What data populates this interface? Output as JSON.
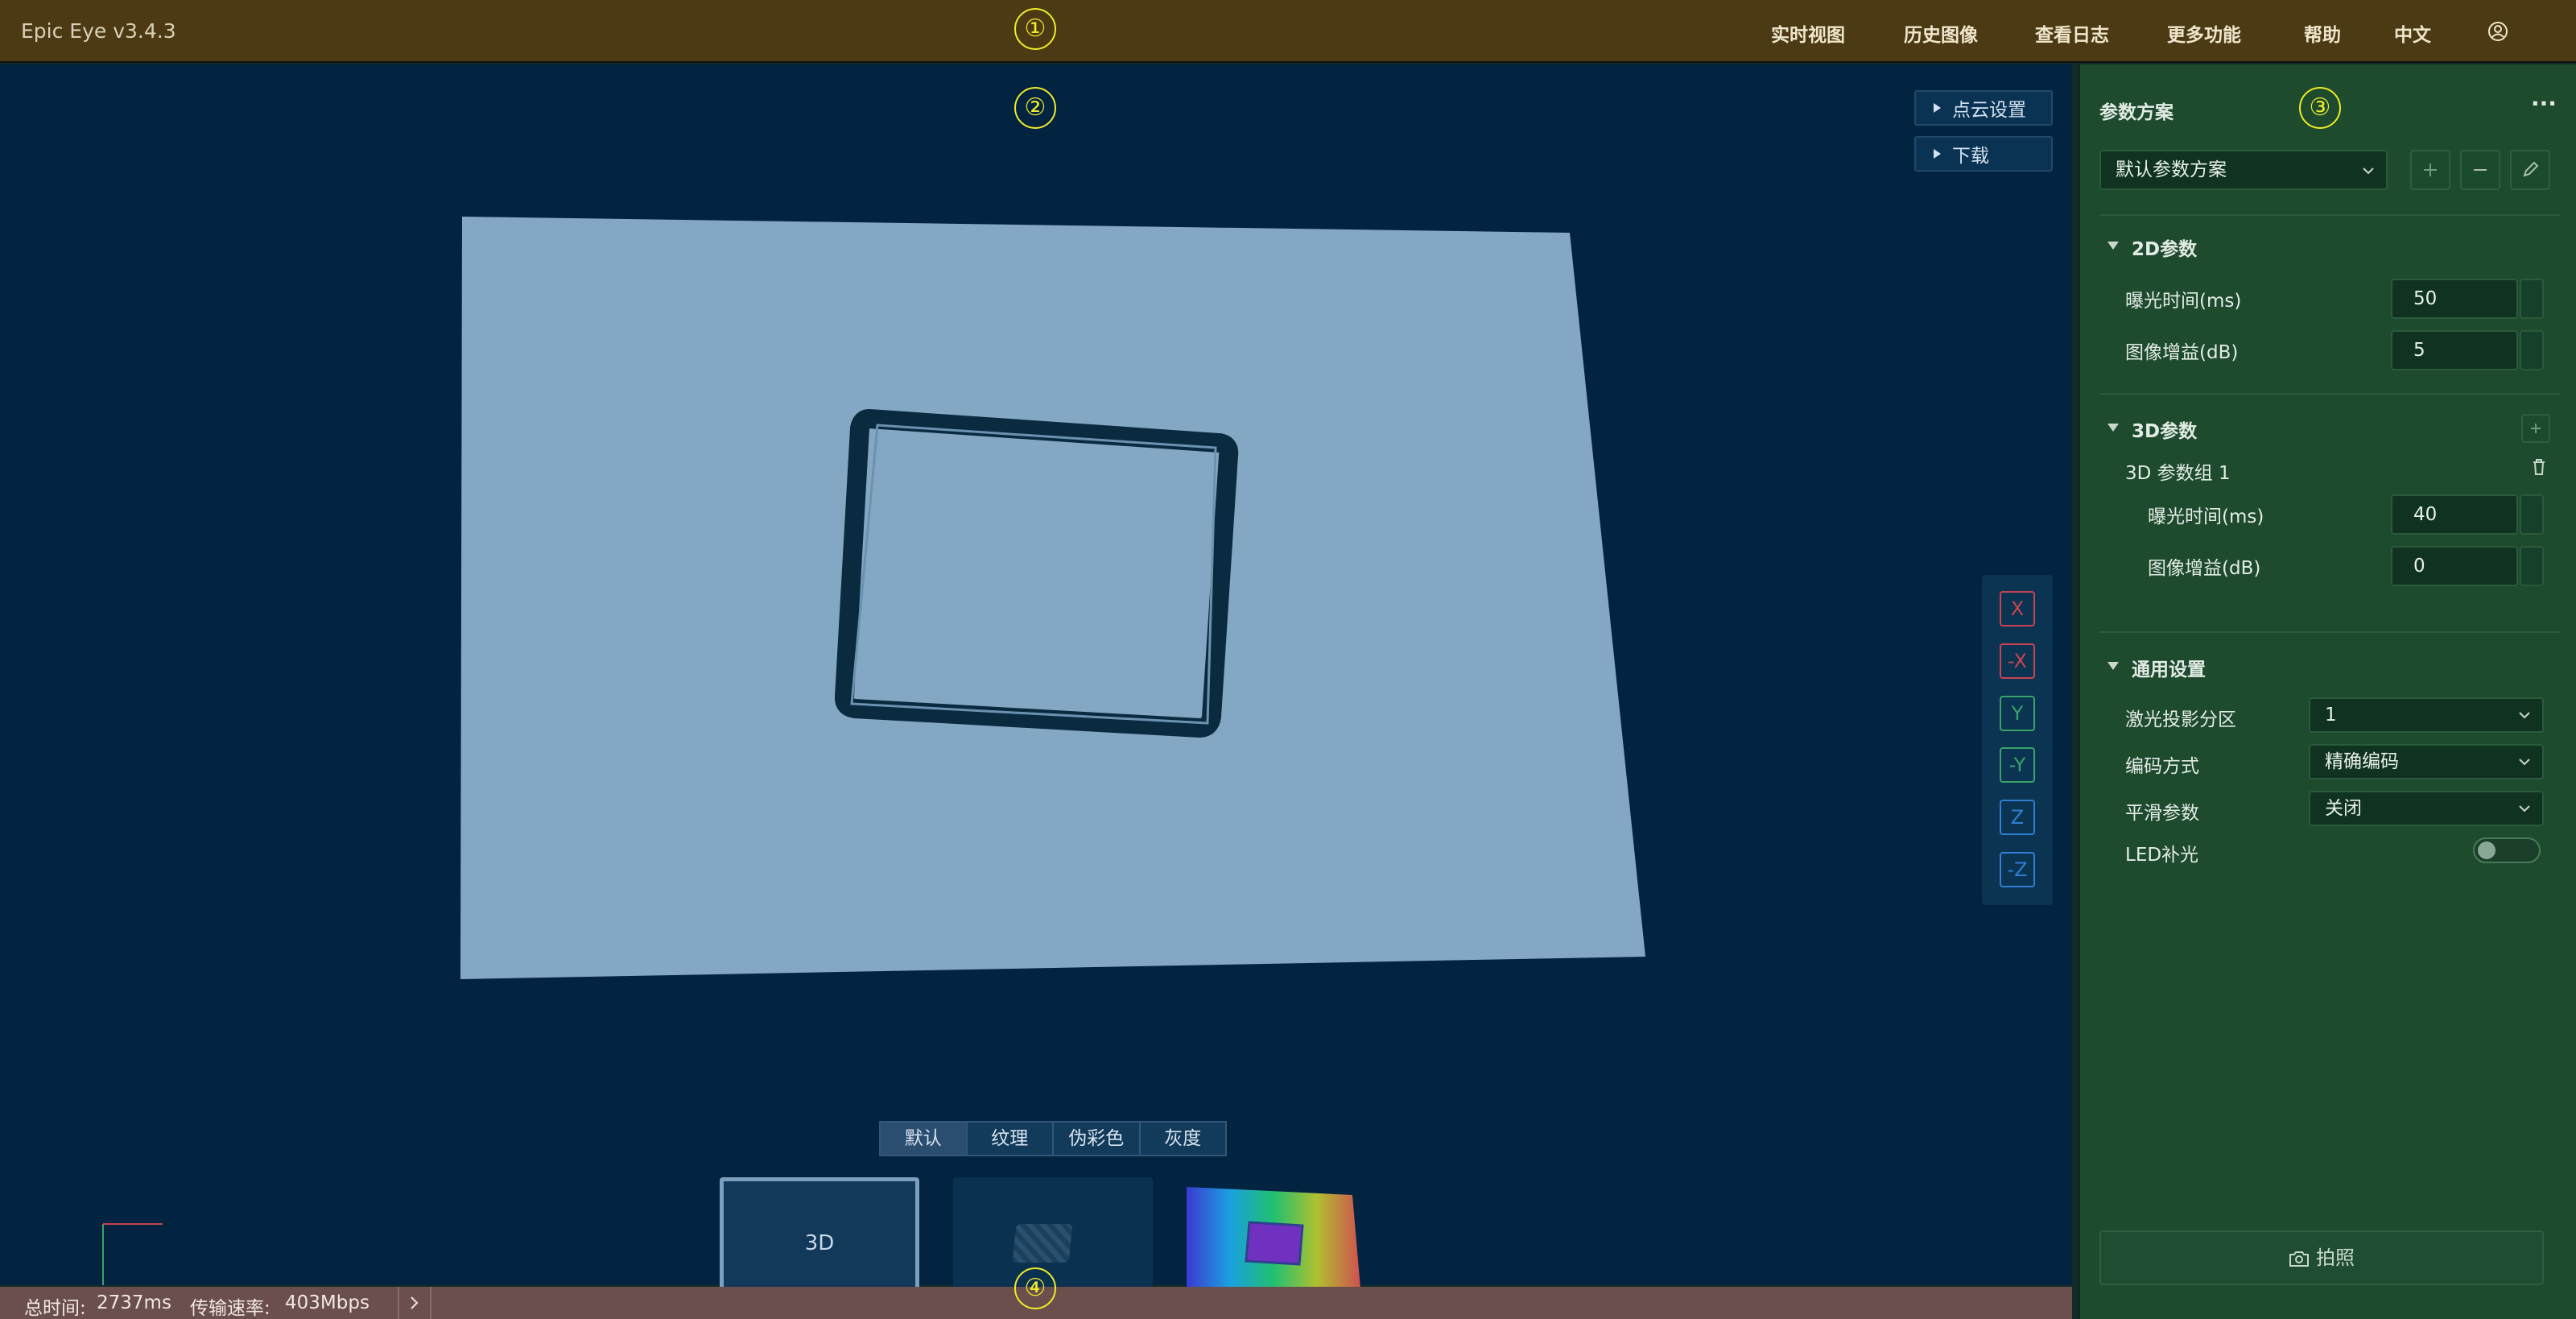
{
  "header": {
    "brand": "Epic Eye v3.4.3",
    "nav": [
      "实时视图",
      "历史图像",
      "查看日志",
      "更多功能",
      "帮助",
      "中文"
    ],
    "user_icon": "user-circle-icon"
  },
  "markers": [
    "①",
    "②",
    "③",
    "④"
  ],
  "viewer": {
    "buttons": [
      {
        "label": "点云设置",
        "icon": "triangle-right-icon"
      },
      {
        "label": "下载",
        "icon": "triangle-right-icon"
      }
    ],
    "axes": [
      {
        "label": "X",
        "color": "#c9434f"
      },
      {
        "label": "-X",
        "color": "#c9434f"
      },
      {
        "label": "Y",
        "color": "#3aa36a"
      },
      {
        "label": "-Y",
        "color": "#3aa36a"
      },
      {
        "label": "Z",
        "color": "#2f7fd2"
      },
      {
        "label": "-Z",
        "color": "#2f7fd2"
      }
    ],
    "modes": [
      "默认",
      "纹理",
      "伪彩色",
      "灰度"
    ],
    "active_mode": "默认",
    "thumbnails": [
      {
        "label": "3D"
      },
      {
        "label": ""
      },
      {
        "label": ""
      }
    ]
  },
  "status": {
    "total_time_label": "总时间:",
    "total_time_value": "2737ms",
    "rate_label": "传输速率:",
    "rate_value": "403Mbps"
  },
  "panel": {
    "title": "参数方案",
    "scheme": "默认参数方案",
    "sections": {
      "s2d": {
        "title": "2D参数",
        "exposure_label": "曝光时间(ms)",
        "exposure": "50",
        "gain_label": "图像增益(dB)",
        "gain": "5"
      },
      "s3d": {
        "title": "3D参数",
        "group": "3D 参数组 1",
        "exposure_label": "曝光时间(ms)",
        "exposure": "40",
        "gain_label": "图像增益(dB)",
        "gain": "0"
      },
      "general": {
        "title": "通用设置",
        "laser_label": "激光投影分区",
        "laser": "1",
        "code_label": "编码方式",
        "code": "精确编码",
        "smooth_label": "平滑参数",
        "smooth": "关闭",
        "led_label": "LED补光",
        "led_on": false
      }
    },
    "capture": "拍照"
  },
  "colors": {
    "header": "#4c3a14",
    "viewer": "#022440",
    "panel": "#1e4a2e",
    "status": "#6b4f4c",
    "marker": "#f0ea2a",
    "cloud": "#84a8c4"
  }
}
